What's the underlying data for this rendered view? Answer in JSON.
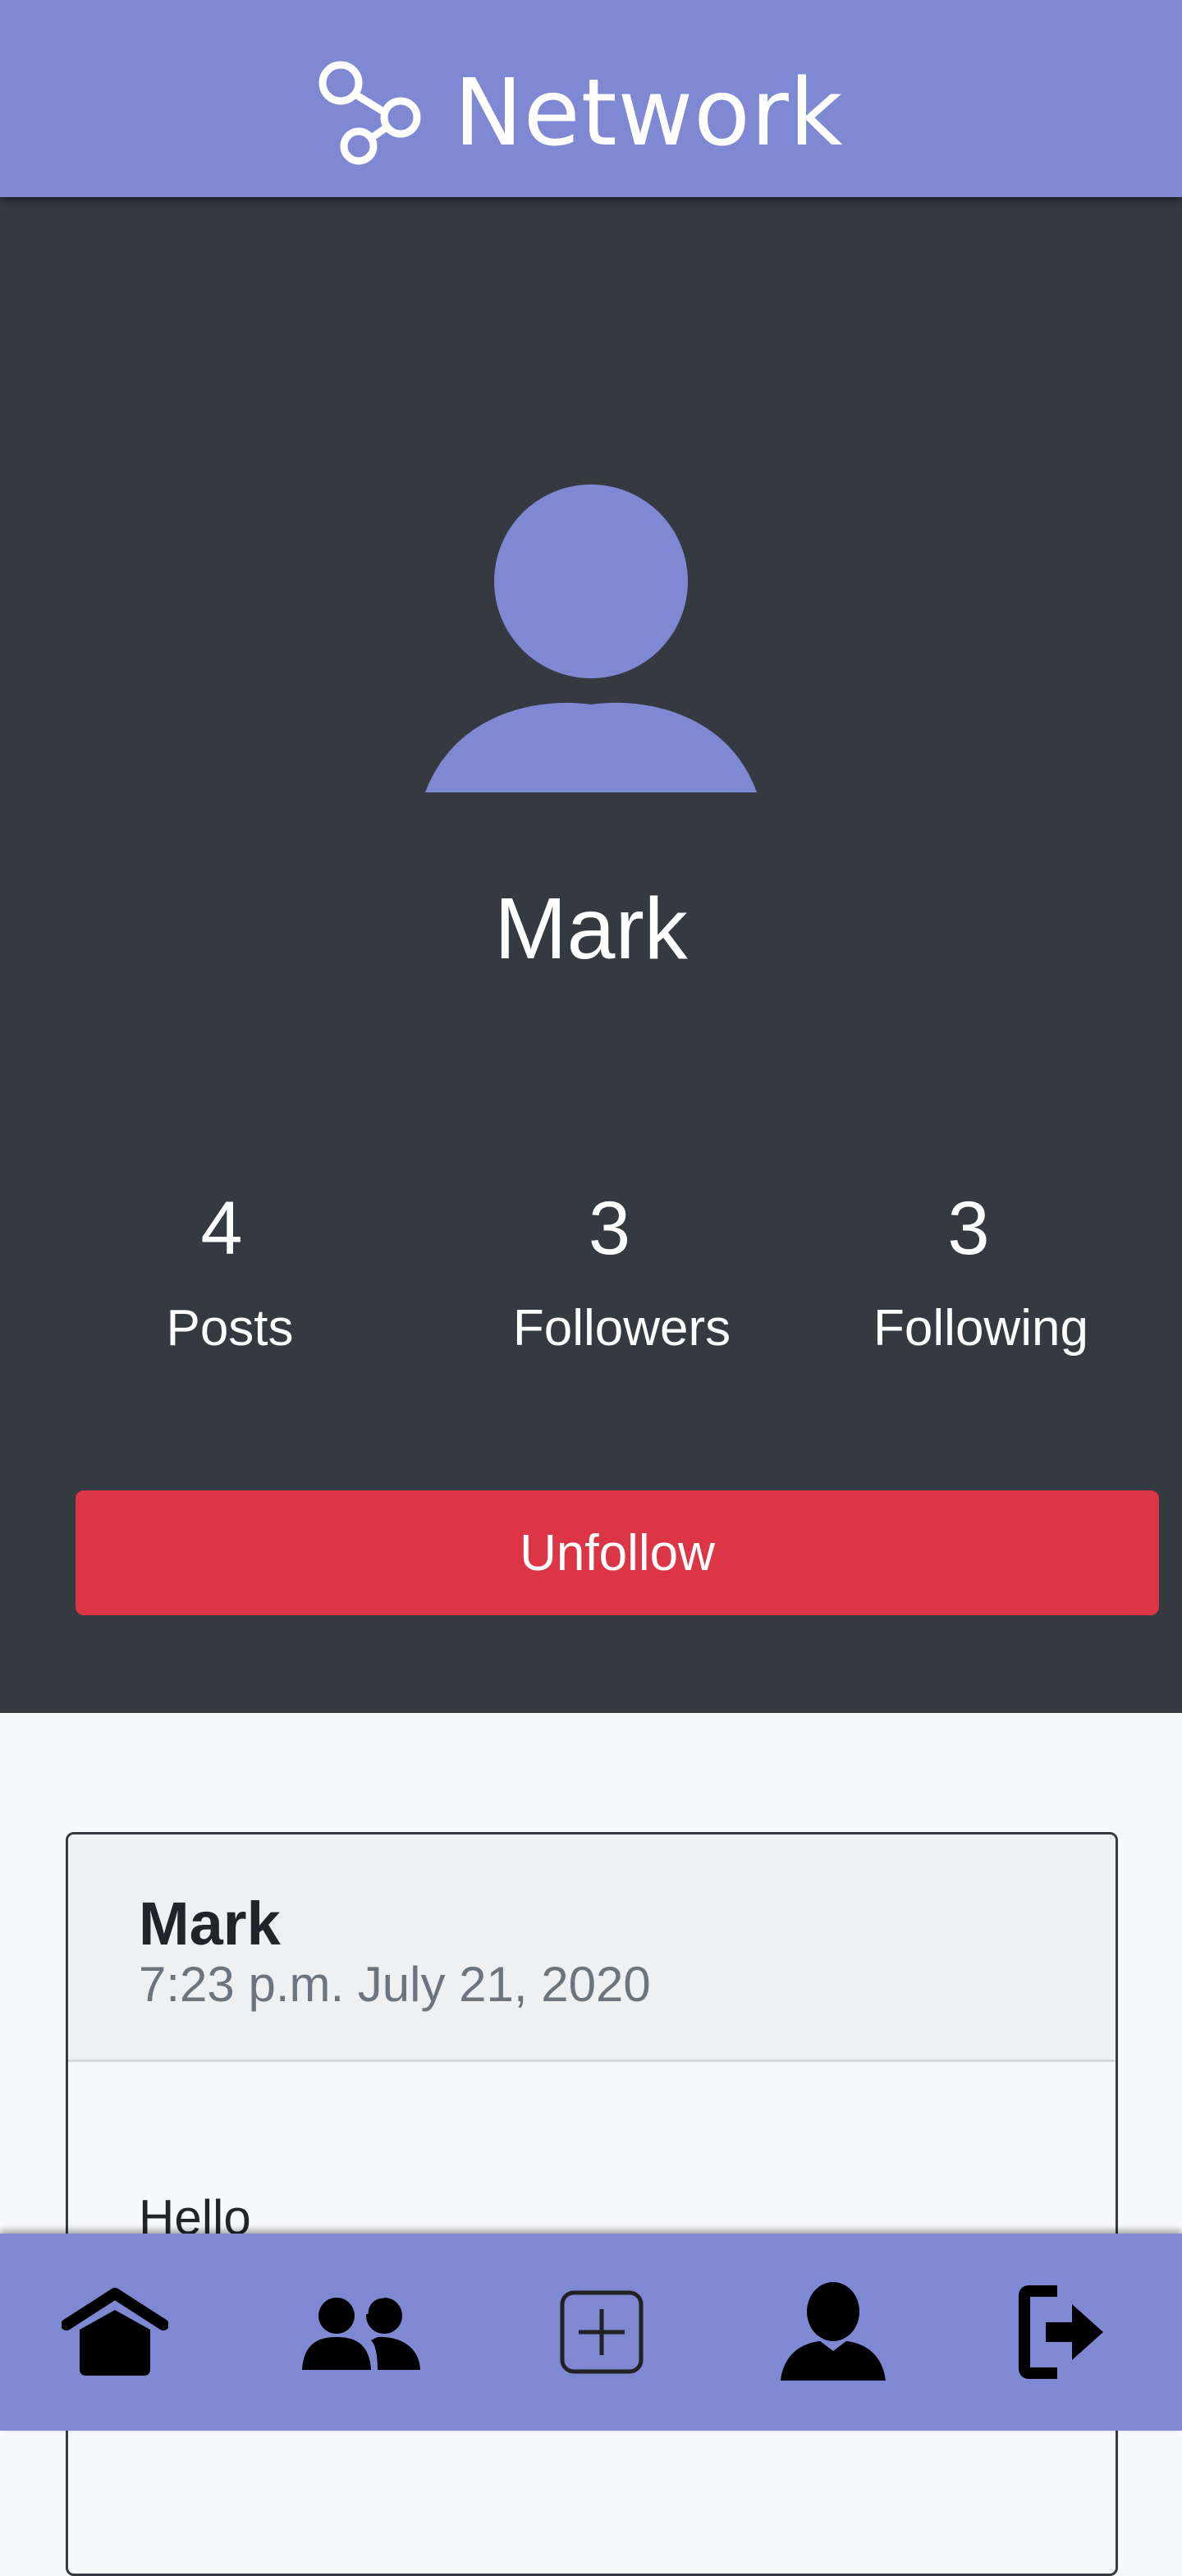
{
  "header": {
    "brand_icon": "network-nodes-icon",
    "title": "Network"
  },
  "colors": {
    "header_bg": "#7f88d3",
    "profile_bg": "#343a40",
    "avatar": "#7f88d3",
    "unfollow_bg": "#dc3545",
    "page_bg": "#f8f9fa"
  },
  "profile": {
    "avatar_icon": "user-silhouette-icon",
    "name": "Mark",
    "stats": [
      {
        "count": "4",
        "label": "Posts"
      },
      {
        "count": "3",
        "label": "Followers"
      },
      {
        "count": "3",
        "label": "Following"
      }
    ],
    "unfollow_label": "Unfollow"
  },
  "posts": [
    {
      "author": "Mark",
      "timestamp": "7:23 p.m. July 21, 2020",
      "content": "Hello"
    }
  ],
  "bottom_nav": [
    {
      "icon": "home-icon"
    },
    {
      "icon": "people-icon"
    },
    {
      "icon": "plus-square-icon"
    },
    {
      "icon": "user-icon"
    },
    {
      "icon": "logout-icon"
    }
  ]
}
